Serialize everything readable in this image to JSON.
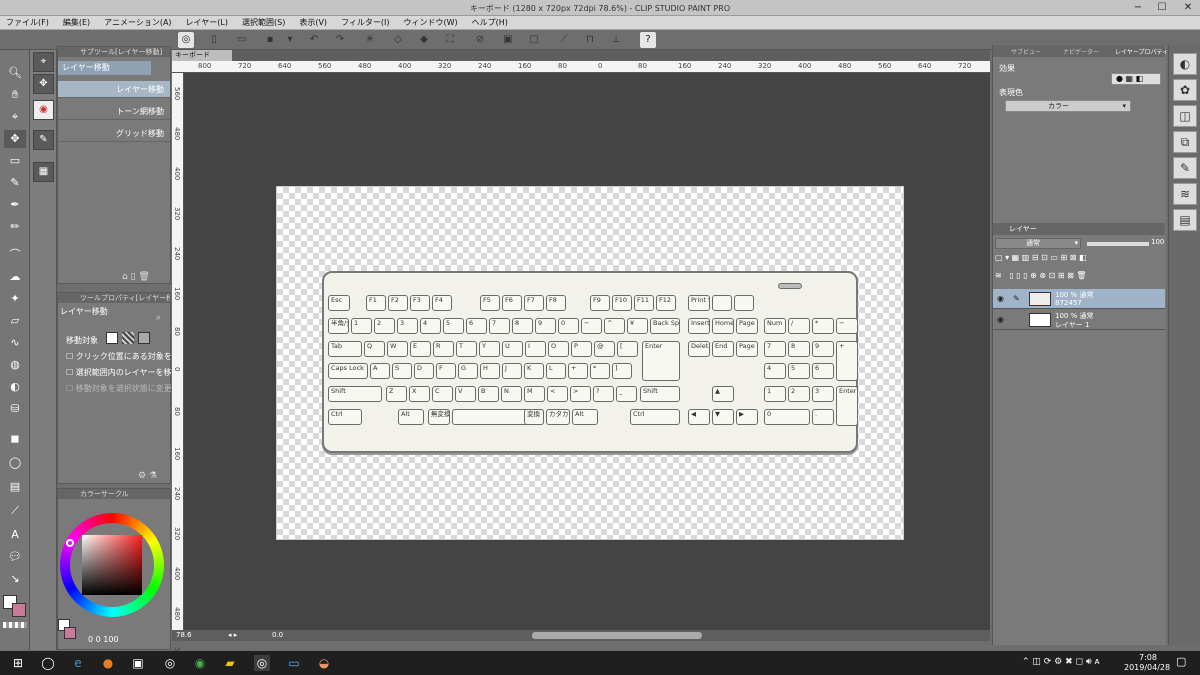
{
  "window": {
    "title": "キーボード (1280 x 720px 72dpi 78.6%) - CLIP STUDIO PAINT PRO"
  },
  "menu": [
    "ファイル(F)",
    "編集(E)",
    "アニメーション(A)",
    "レイヤー(L)",
    "選択範囲(S)",
    "表示(V)",
    "フィルター(I)",
    "ウィンドウ(W)",
    "ヘルプ(H)"
  ],
  "doc_tab": "キーボード",
  "ruler_h": [
    "800",
    "720",
    "640",
    "560",
    "480",
    "400",
    "320",
    "240",
    "160",
    "80",
    "0",
    "80",
    "160",
    "240",
    "320",
    "400",
    "480",
    "560",
    "640",
    "720"
  ],
  "ruler_v": [
    "560",
    "480",
    "400",
    "320",
    "240",
    "160",
    "80",
    "0",
    "80",
    "160",
    "240",
    "320",
    "400",
    "480",
    "560"
  ],
  "subtool": {
    "header": "サブツール[レイヤー移動]",
    "group": "レイヤー移動",
    "items": [
      "レイヤー移動",
      "トーン網移動",
      "グリッド移動"
    ]
  },
  "toolprop": {
    "header": "ツールプロパティ[レイヤー移動]",
    "title": "レイヤー移動",
    "target_label": "移動対象",
    "options": [
      "クリック位置にある対象を移動",
      "選択範囲内のレイヤーを移動",
      "移動対象を選択状態に変更"
    ]
  },
  "colorwheel": {
    "header": "カラーサークル",
    "readout": "0 0 100"
  },
  "rightpanel": {
    "tabs": [
      "サブビュー",
      "ナビゲーター",
      "レイヤープロパティ"
    ],
    "effect_label": "効果",
    "color_label": "表現色",
    "color_value": "カラー",
    "layer_tab": "レイヤー",
    "blend_mode": "通常",
    "opacity": "100",
    "layers": [
      {
        "line1": "100 % 通常",
        "line2": "872457"
      },
      {
        "line1": "100 % 通常",
        "line2": "レイヤー 1"
      }
    ]
  },
  "status": {
    "zoom": "78.6",
    "rot": "0.0"
  },
  "clock": {
    "time": "7:08",
    "date": "2019/04/28"
  },
  "keyboard": {
    "row_fn": [
      "Esc",
      "F1",
      "F2",
      "F3",
      "F4",
      "F5",
      "F6",
      "F7",
      "F8",
      "F9",
      "F10",
      "F11",
      "F12",
      "Print Screen"
    ],
    "row_num": [
      "半角/全角",
      "1",
      "2",
      "3",
      "4",
      "5",
      "6",
      "7",
      "8",
      "9",
      "0",
      "−",
      "^",
      "¥",
      "Back Space"
    ],
    "row_q": [
      "Tab",
      "Q",
      "W",
      "E",
      "R",
      "T",
      "Y",
      "U",
      "I",
      "O",
      "P",
      "@",
      "[",
      "Enter"
    ],
    "row_a": [
      "Caps Lock",
      "A",
      "S",
      "D",
      "F",
      "G",
      "H",
      "J",
      "K",
      "L",
      "+",
      "*",
      "]"
    ],
    "row_z": [
      "Shift",
      "Z",
      "X",
      "C",
      "V",
      "B",
      "N",
      "M",
      "<",
      ">",
      "?",
      "_",
      "Shift"
    ],
    "row_ctrl": [
      "Ctrl",
      "Alt",
      "無変換",
      "変換",
      "カタカナ",
      "Alt",
      "Ctrl"
    ],
    "nav": [
      "Insert",
      "Home",
      "Page Up",
      "Delete",
      "End",
      "Page Down"
    ],
    "num": [
      "Num Lock",
      "/",
      "*",
      "−",
      "7",
      "8",
      "9",
      "+",
      "4",
      "5",
      "6",
      "1",
      "2",
      "3",
      "Enter",
      "0",
      "."
    ]
  }
}
